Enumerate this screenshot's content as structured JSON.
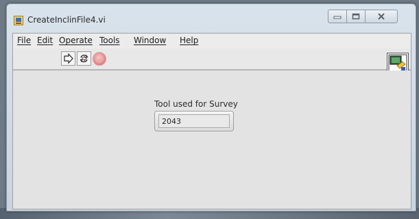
{
  "window": {
    "title": "CreateInclinFile4.vi"
  },
  "icons": {
    "app": "labview-vi-icon",
    "minimize": "minimize-icon",
    "maximize": "maximize-icon",
    "close": "close-icon",
    "run": "run-arrow-icon",
    "run_continuously": "run-continuously-icon",
    "abort": "abort-stop-icon",
    "vi_connector": "vi-connector-pane-icon"
  },
  "menu": {
    "items": [
      {
        "label": "File"
      },
      {
        "label": "Edit"
      },
      {
        "label": "Operate"
      },
      {
        "label": "Tools"
      },
      {
        "label": "Window"
      },
      {
        "label": "Help"
      }
    ]
  },
  "front_panel": {
    "control": {
      "label": "Tool used for Survey",
      "value": "2043"
    }
  },
  "colors": {
    "panel_background": "#e3e3e3",
    "abort_button": "#e07f7f",
    "title_bar": "#d9e3ec"
  }
}
